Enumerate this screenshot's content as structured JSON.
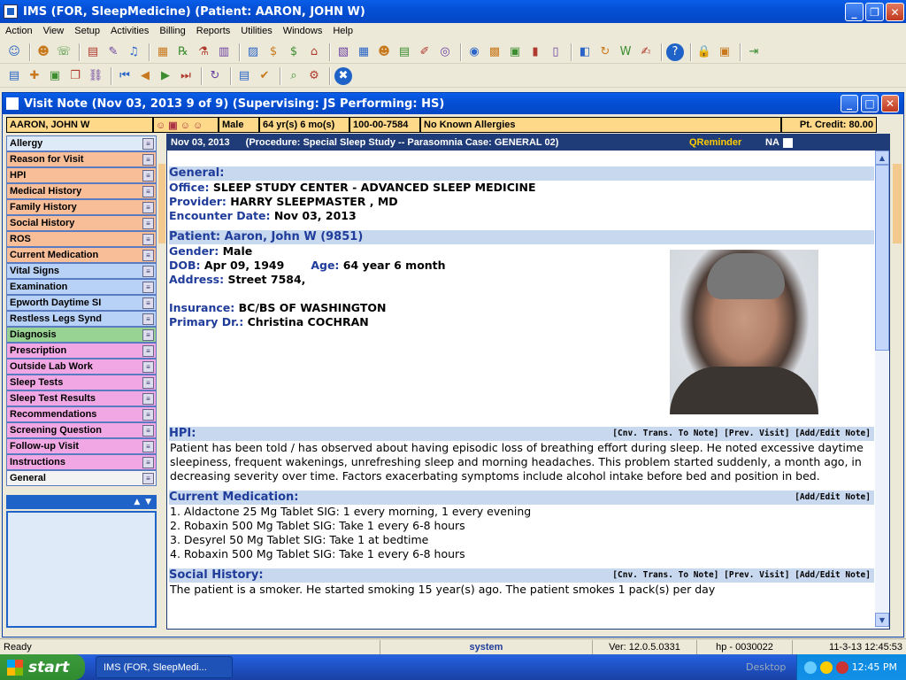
{
  "window": {
    "title": "IMS (FOR, SleepMedicine)      (Patient: AARON, JOHN W)"
  },
  "menu": [
    "Action",
    "View",
    "Setup",
    "Activities",
    "Billing",
    "Reports",
    "Utilities",
    "Windows",
    "Help"
  ],
  "toolbar1": [
    "user-icon",
    "users-icon",
    "phone-icon",
    "folder-icon",
    "edit-icon",
    "mic-icon",
    "chart-icon",
    "rx-icon",
    "flask-icon",
    "doc-icon",
    "image-icon",
    "dollar-icon",
    "dollar-card-icon",
    "bank-icon",
    "invoice-icon",
    "grid-icon",
    "people-icon",
    "report-icon",
    "pen-icon",
    "globe-icon",
    "world-icon",
    "folder-grid-icon",
    "form-icon",
    "bar-chart-icon",
    "building-icon",
    "layers-icon",
    "refresh-icon",
    "word-icon",
    "note-icon",
    "help-icon",
    "lock-icon",
    "lock2-icon",
    "exit-icon"
  ],
  "toolbar2": [
    "open-icon",
    "new-icon",
    "save-icon",
    "copy-icon",
    "link-icon",
    "first-icon",
    "prev-icon",
    "next-icon",
    "last-icon",
    "reload-icon",
    "clipboard-icon",
    "check-icon",
    "search-icon",
    "gear-icon",
    "close-icon"
  ],
  "visit": {
    "title": "Visit Note (Nov 03, 2013    9 of 9) (Supervising: JS Performing: HS)"
  },
  "patientbar": {
    "name": "AARON, JOHN W",
    "sex": "Male",
    "age": "64 yr(s) 6 mo(s)",
    "id": "100-00-7584",
    "allergy": "No Known Allergies",
    "credit": "Pt. Credit: 80.00"
  },
  "nav": [
    {
      "label": "Allergy",
      "c": "c-blue"
    },
    {
      "label": "Reason for Visit",
      "c": "c-orange"
    },
    {
      "label": "HPI",
      "c": "c-orange"
    },
    {
      "label": "Medical History",
      "c": "c-orange"
    },
    {
      "label": "Family History",
      "c": "c-orange"
    },
    {
      "label": "Social History",
      "c": "c-orange"
    },
    {
      "label": "ROS",
      "c": "c-orange"
    },
    {
      "label": "Current Medication",
      "c": "c-orange"
    },
    {
      "label": "Vital Signs",
      "c": "c-lblue"
    },
    {
      "label": "Examination",
      "c": "c-lblue"
    },
    {
      "label": "Epworth Daytime SI",
      "c": "c-lblue"
    },
    {
      "label": "Restless Legs Synd",
      "c": "c-lblue"
    },
    {
      "label": "Diagnosis",
      "c": "c-green"
    },
    {
      "label": "Prescription",
      "c": "c-pink"
    },
    {
      "label": "Outside Lab Work",
      "c": "c-pink"
    },
    {
      "label": "Sleep Tests",
      "c": "c-pink"
    },
    {
      "label": "Sleep Test Results",
      "c": "c-pink"
    },
    {
      "label": "Recommendations",
      "c": "c-pink"
    },
    {
      "label": "Screening Question",
      "c": "c-pink"
    },
    {
      "label": "Follow-up Visit",
      "c": "c-pink"
    },
    {
      "label": "Instructions",
      "c": "c-pink"
    },
    {
      "label": "General",
      "c": "c-white"
    }
  ],
  "header": {
    "date": "Nov 03, 2013",
    "procedure": "(Procedure:  Special Sleep Study -- Parasomnia  Case: GENERAL 02)",
    "qreminder": "QReminder",
    "na": "NA"
  },
  "general": {
    "title": "General:",
    "office_k": "Office:",
    "office_v": "SLEEP STUDY CENTER - ADVANCED SLEEP MEDICINE",
    "provider_k": "Provider:",
    "provider_v": "HARRY SLEEPMASTER , MD",
    "enc_k": "Encounter Date:",
    "enc_v": "Nov 03, 2013"
  },
  "patient": {
    "title": "Patient: Aaron, John W   (9851)",
    "gender_k": "Gender:",
    "gender_v": "Male",
    "dob_k": "DOB:",
    "dob_v": "Apr 09, 1949",
    "age_k": "Age:",
    "age_v": "64 year 6 month",
    "addr_k": "Address:",
    "addr_v": "Street 7584,",
    "ins_k": "Insurance:",
    "ins_v": "BC/BS OF WASHINGTON",
    "pdr_k": "Primary Dr.:",
    "pdr_v": "Christina  COCHRAN"
  },
  "hpi": {
    "title": "HPI:",
    "actions": "[Cnv. Trans. To Note]  [Prev. Visit]  [Add/Edit Note]",
    "text": "Patient has been told / has observed about having episodic loss of breathing effort during sleep. He noted excessive daytime sleepiness, frequent wakenings, unrefreshing sleep and morning headaches. This problem started suddenly, a month ago, in decreasing severity over time. Factors exacerbating symptoms include alcohol intake before bed and position in bed."
  },
  "meds": {
    "title": "Current Medication:",
    "actions": "[Add/Edit Note]",
    "items": [
      "1. Aldactone 25 Mg Tablet  SIG: 1 every morning,  1 every evening",
      "2. Robaxin 500 Mg Tablet  SIG: Take 1 every 6-8 hours",
      "3. Desyrel 50 Mg Tablet  SIG: Take 1 at bedtime",
      "4. Robaxin 500 Mg Tablet  SIG: Take 1 every 6-8 hours"
    ]
  },
  "social": {
    "title": "Social History:",
    "actions": "[Cnv. Trans. To Note]  [Prev. Visit]  [Add/Edit Note]",
    "text": "The patient is a smoker. He started smoking 15 year(s) ago. The patient smokes 1 pack(s) per day"
  },
  "status": {
    "ready": "Ready",
    "user": "system",
    "ver": "Ver: 12.0.5.0331",
    "host": "hp - 0030022",
    "datetime": "11-3-13 12:45:53"
  },
  "taskbar": {
    "start": "start",
    "item": "IMS (FOR, SleepMedi...",
    "desktop": "Desktop",
    "clock": "12:45 PM"
  }
}
